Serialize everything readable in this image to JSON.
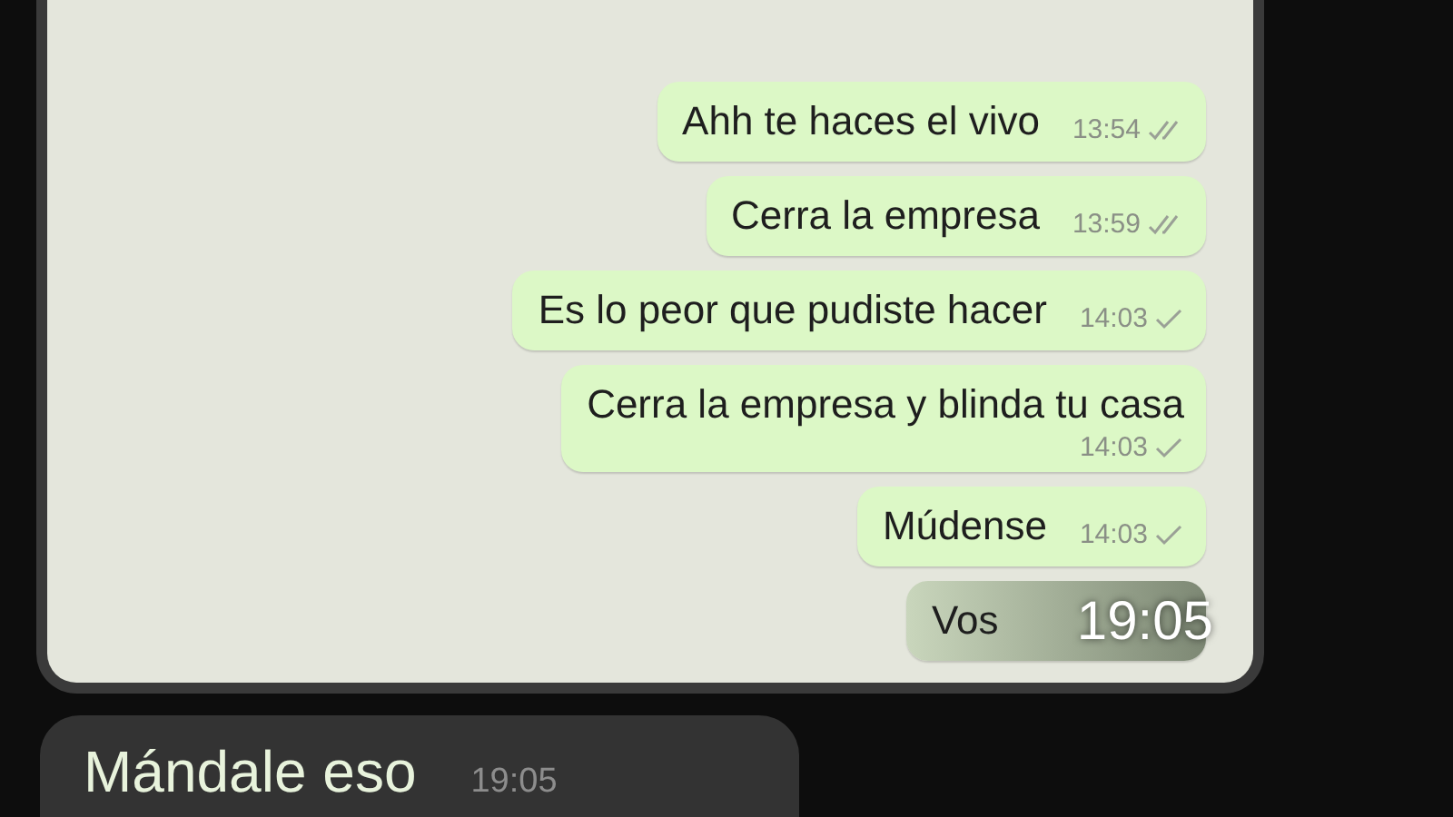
{
  "screenshot_messages": [
    {
      "text": "Ahh te haces el vivo",
      "time": "13:54",
      "read": true,
      "time_below": false
    },
    {
      "text": "Cerra la empresa",
      "time": "13:59",
      "read": true,
      "time_below": false
    },
    {
      "text": "Es lo peor que pudiste hacer",
      "time": "14:03",
      "read": false,
      "time_below": false
    },
    {
      "text": "Cerra la empresa y blinda tu casa",
      "time": "14:03",
      "read": false,
      "time_below": true
    },
    {
      "text": "Múdense",
      "time": "14:03",
      "read": false,
      "time_below": false
    },
    {
      "text": "Vos",
      "overlay_time": "19:05",
      "time_below": false
    }
  ],
  "reply": {
    "text": "Mándale eso",
    "time": "19:05"
  }
}
